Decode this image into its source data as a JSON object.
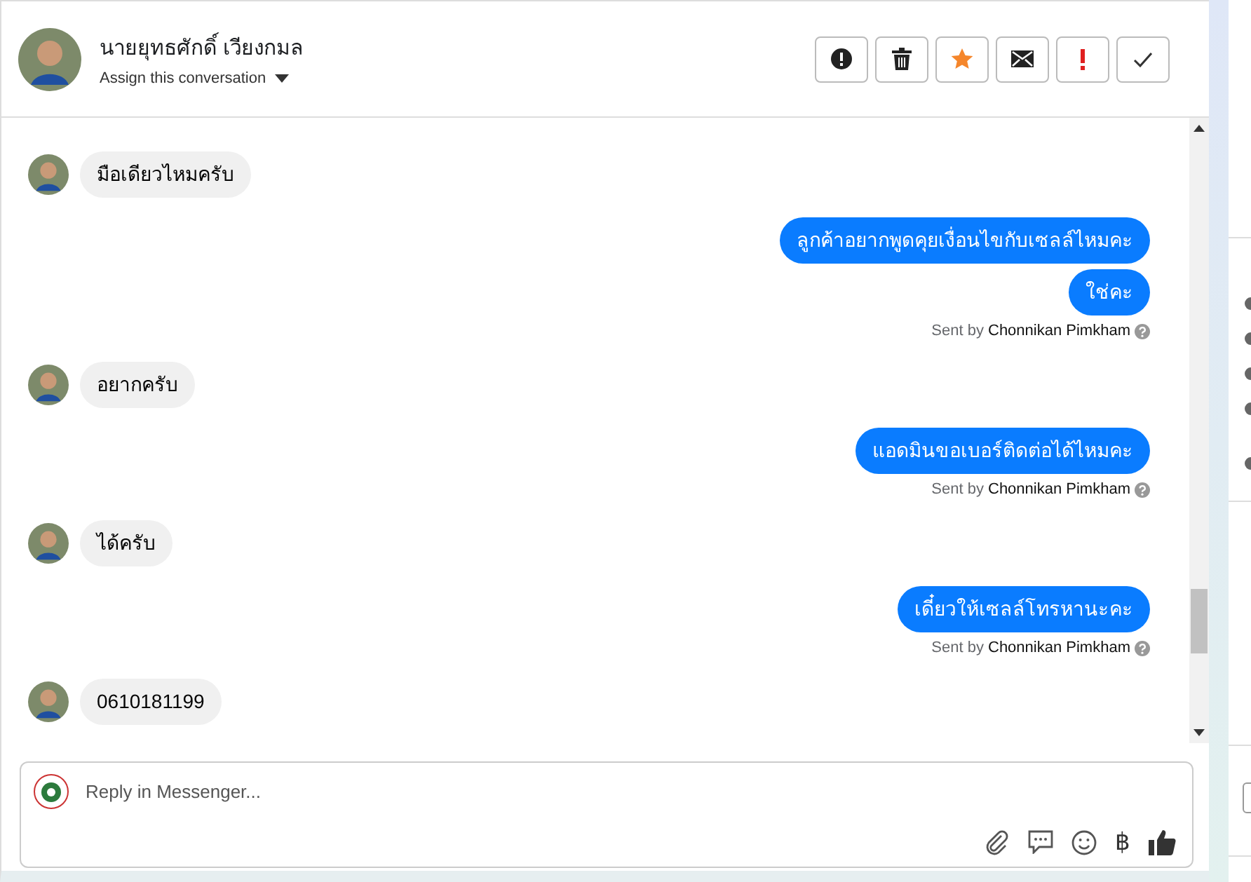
{
  "conversation": {
    "contact_name": "นายยุทธศักดิ์ เวียงกมล",
    "assign_label": "Assign this conversation"
  },
  "messages": [
    {
      "kind": "incoming",
      "text": "มือเดียวไหมครับ"
    },
    {
      "kind": "outgoing",
      "text": "ลูกค้าอยากพูดคุยเงื่อนไขกับเซลล์ไหมคะ"
    },
    {
      "kind": "outgoing",
      "text": "ใช่คะ"
    },
    {
      "kind": "sent_by",
      "label": "Sent by",
      "name": "Chonnikan Pimkham"
    },
    {
      "kind": "incoming",
      "text": "อยากครับ"
    },
    {
      "kind": "outgoing",
      "text": "แอดมินขอเบอร์ติดต่อได้ไหมคะ"
    },
    {
      "kind": "sent_by",
      "label": "Sent by",
      "name": "Chonnikan Pimkham"
    },
    {
      "kind": "incoming",
      "text": "ได้ครับ"
    },
    {
      "kind": "outgoing",
      "text": "เดี๋ยวให้เซลล์โทรหานะคะ"
    },
    {
      "kind": "sent_by",
      "label": "Sent by",
      "name": "Chonnikan Pimkham"
    },
    {
      "kind": "incoming",
      "text": "0610181199"
    }
  ],
  "composer": {
    "placeholder": "Reply in Messenger...",
    "currency_symbol": "฿"
  }
}
